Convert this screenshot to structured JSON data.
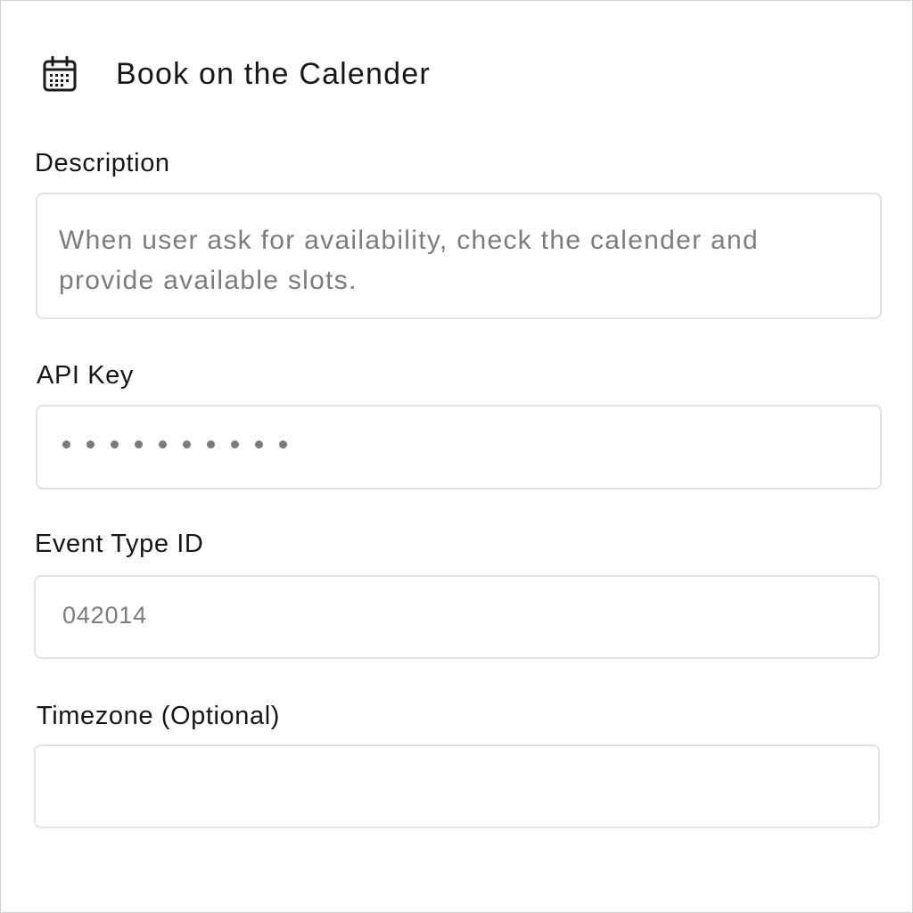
{
  "header": {
    "icon": "calendar-icon",
    "title": "Book on the Calender"
  },
  "fields": {
    "description": {
      "label": "Description",
      "value": "When user ask for availability, check the calender and\nprovide available slots."
    },
    "api_key": {
      "label": "API Key",
      "masked_length": 10
    },
    "event_type_id": {
      "label": "Event Type ID",
      "value": "042014"
    },
    "timezone": {
      "label": "Timezone (Optional)",
      "value": ""
    }
  },
  "colors": {
    "border": "#e2e2e2",
    "placeholder_text": "#7c7c7c",
    "label_text": "#161616"
  }
}
